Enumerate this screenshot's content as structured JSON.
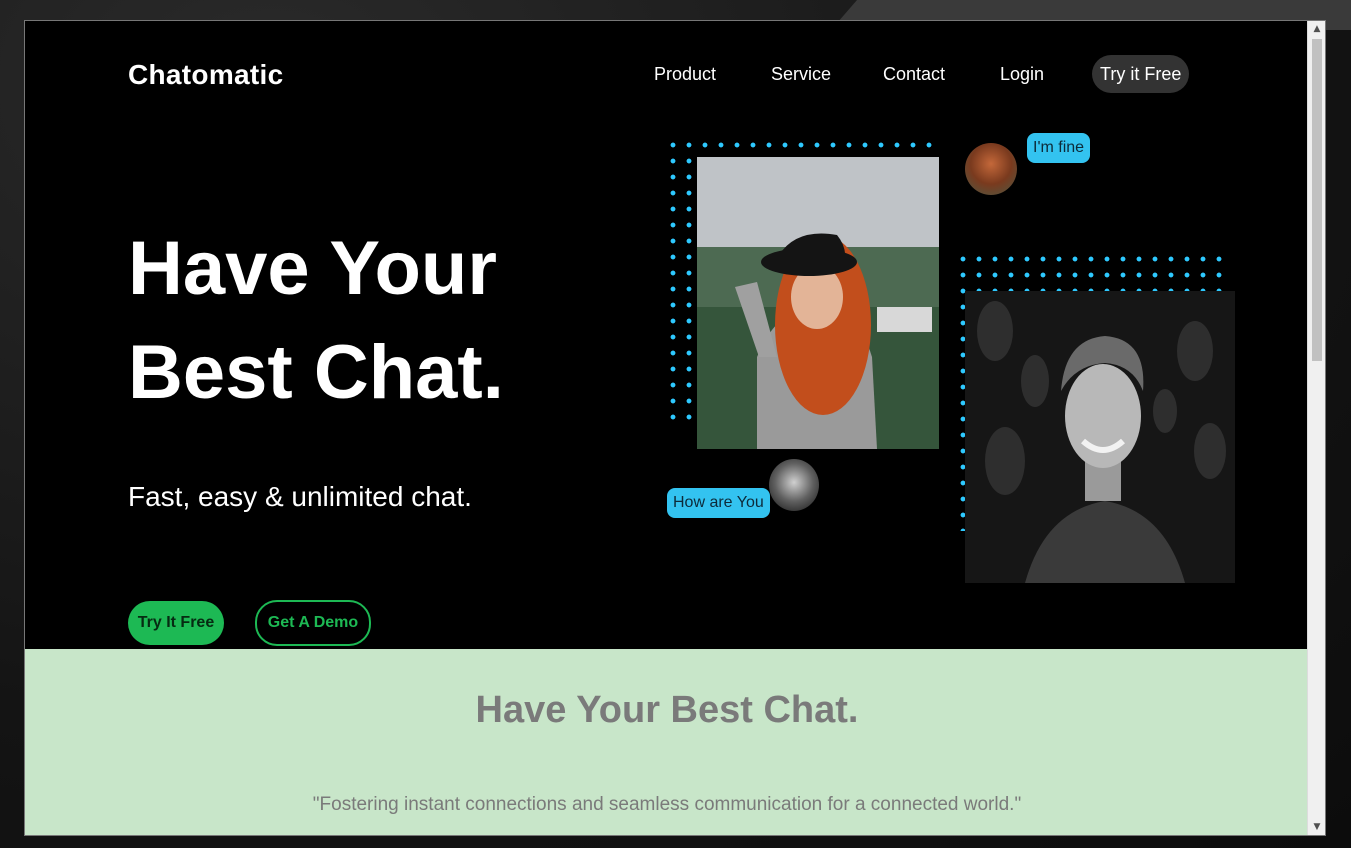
{
  "brand": {
    "name": "Chatomatic"
  },
  "nav": {
    "items": [
      "Product",
      "Service",
      "Contact",
      "Login"
    ],
    "cta_label": "Try it Free"
  },
  "hero": {
    "headline_line1": "Have Your",
    "headline_line2": "Best Chat.",
    "subheading": "Fast, easy & unlimited chat.",
    "primary_button": "Try It Free",
    "secondary_button": "Get A Demo",
    "chat": {
      "bubble_1": "I'm fine",
      "bubble_2": "How are You"
    }
  },
  "section": {
    "title": "Have Your Best Chat.",
    "quote": "\"Fostering instant connections and seamless communication for a connected world.\""
  },
  "colors": {
    "accent": "#1db954",
    "bubble": "#33c3f0",
    "section_bg": "#c8e6c9",
    "hero_bg": "#000000"
  },
  "icons": {
    "scroll_up": "scroll-up-arrow-icon",
    "scroll_down": "scroll-down-arrow-icon"
  }
}
